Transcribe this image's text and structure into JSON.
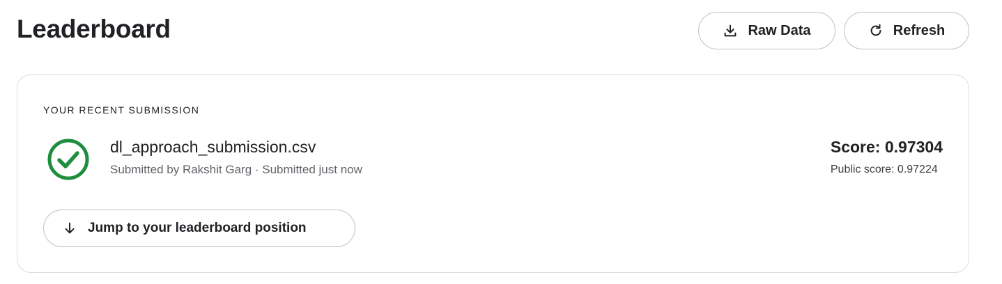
{
  "header": {
    "title": "Leaderboard",
    "raw_data_label": "Raw Data",
    "refresh_label": "Refresh"
  },
  "submission": {
    "section_label": "YOUR RECENT SUBMISSION",
    "file_name": "dl_approach_submission.csv",
    "meta": "Submitted by Rakshit Garg · Submitted just now",
    "score": "Score: 0.97304",
    "public_score": "Public score: 0.97224",
    "jump_label": "Jump to your leaderboard position",
    "status_icon": "check-circle-icon",
    "status_color": "#1e8e3e"
  },
  "colors": {
    "text": "#202124",
    "muted": "#5f6368",
    "border": "#dadce0",
    "success": "#1e8e3e"
  }
}
